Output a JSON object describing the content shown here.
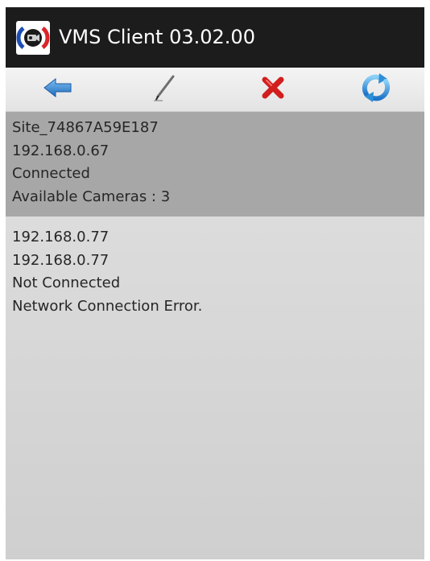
{
  "app": {
    "title": "VMS Client 03.02.00",
    "icon": "camera-app-icon"
  },
  "toolbar": {
    "buttons": [
      {
        "name": "back",
        "icon": "left-arrow-icon",
        "color": "#2f7fc9"
      },
      {
        "name": "edit",
        "icon": "pencil-icon",
        "color": "#5a5a5a"
      },
      {
        "name": "delete",
        "icon": "red-x-icon",
        "color": "#d21e1e"
      },
      {
        "name": "refresh",
        "icon": "refresh-icon",
        "color": "#2f8fd6"
      }
    ]
  },
  "sites": [
    {
      "name": "Site_74867A59E187",
      "address": "192.168.0.67",
      "status": "Connected",
      "detail": "Available Cameras : 3",
      "selected": true
    },
    {
      "name": "192.168.0.77",
      "address": "192.168.0.77",
      "status": "Not Connected",
      "detail": "Network Connection Error.",
      "selected": false
    }
  ],
  "colors": {
    "titlebar": "#1c1c1c",
    "selected_row": "#a7a7a7",
    "text": "#262626"
  }
}
